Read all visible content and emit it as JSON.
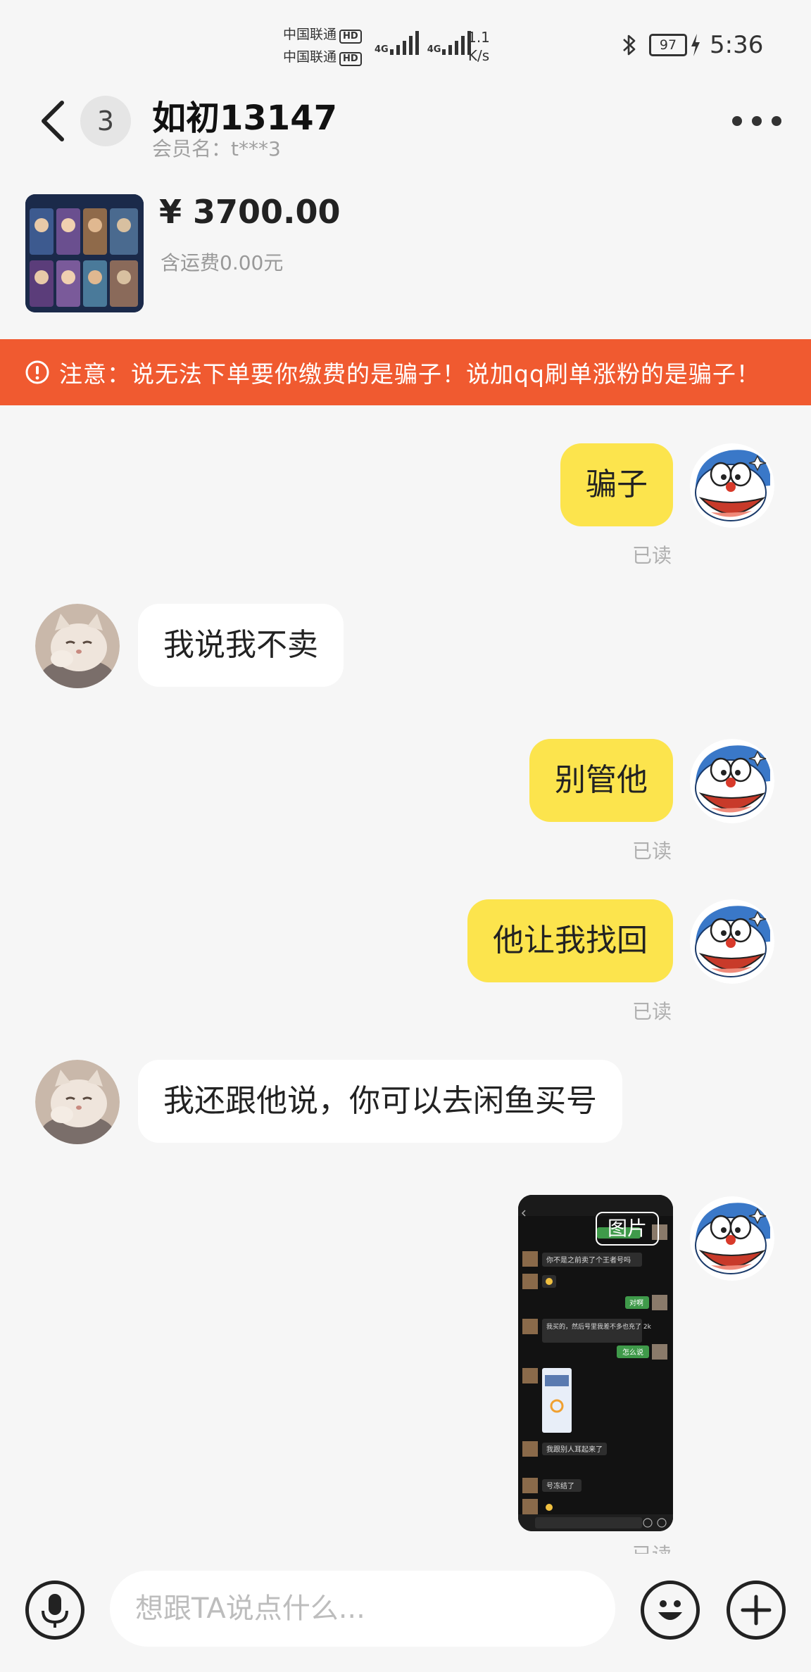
{
  "status_bar": {
    "carrier1": "中国联通",
    "carrier2": "中国联通",
    "hd": "HD",
    "net": "4G",
    "speed_value": "1.1",
    "speed_unit": "K/s",
    "battery": "97",
    "time": "5:36"
  },
  "header": {
    "unread_count": "3",
    "contact_name": "如初13147",
    "member_label": "会员名：t***3"
  },
  "product": {
    "price": "¥ 3700.00",
    "shipping": "含运费0.00元"
  },
  "warning": {
    "text": "注意：说无法下单要你缴费的是骗子！说加qq刷单涨粉的是骗子！"
  },
  "messages": [
    {
      "side": "me",
      "text": "骗子",
      "status": "已读"
    },
    {
      "side": "them",
      "text": "我说我不卖"
    },
    {
      "side": "me",
      "text": "别管他",
      "status": "已读"
    },
    {
      "side": "me",
      "text": "他让我找回",
      "status": "已读"
    },
    {
      "side": "them",
      "text": "我还跟他说，你可以去闲鱼买号"
    },
    {
      "side": "me",
      "type": "image",
      "label": "图片",
      "status": "已读"
    }
  ],
  "screenshot_preview": {
    "lines": [
      "你不是之前卖了个王者号吗",
      "对啊",
      "我买的，然后号里我差不多也充了 2k",
      "怎么说",
      "我跟别人耳起来了",
      "号冻结了"
    ]
  },
  "input": {
    "placeholder": "想跟TA说点什么..."
  },
  "colors": {
    "my_bubble": "#fce44d",
    "their_bubble": "#ffffff",
    "warning_bg": "#f05a30",
    "background": "#f6f6f6"
  }
}
